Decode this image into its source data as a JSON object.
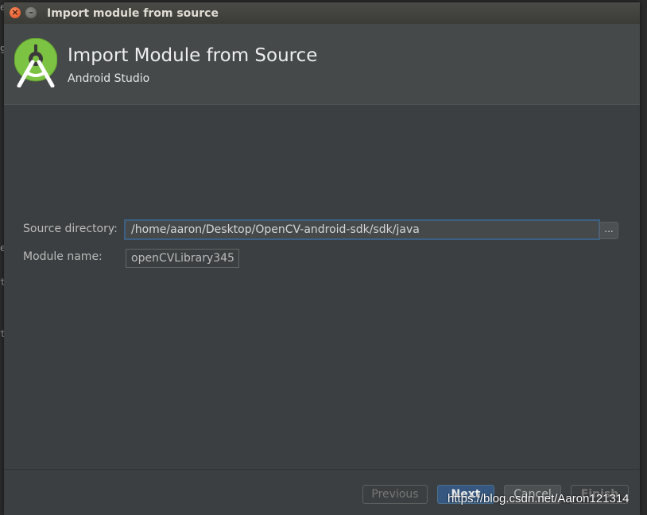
{
  "window": {
    "title": "Import module from source"
  },
  "header": {
    "title": "Import Module from Source",
    "subtitle": "Android Studio",
    "logo_icon": "android-studio-icon"
  },
  "form": {
    "source_directory": {
      "label": "Source directory:",
      "value": "/home/aaron/Desktop/OpenCV-android-sdk/sdk/java",
      "browse_label": "..."
    },
    "module_name": {
      "label": "Module name:",
      "value": "openCVLibrary345"
    }
  },
  "buttons": {
    "previous": "Previous",
    "next": "Next",
    "cancel": "Cancel",
    "finish": "Finish"
  },
  "watermark": "https://blog.csdn.net/Aaron121314",
  "colors": {
    "accent": "#365880",
    "dialog_bg": "#3c3f41",
    "header_bg": "#45494a",
    "focus_border": "#3d6185"
  }
}
